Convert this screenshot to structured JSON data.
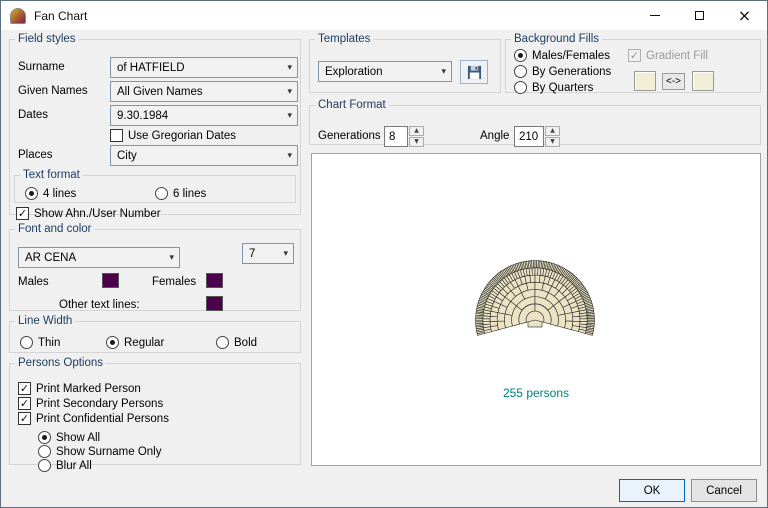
{
  "window": {
    "title": "Fan Chart"
  },
  "icons": {
    "combo_arrow": "▾",
    "check": "✓",
    "spin_up": "▲",
    "spin_down": "▼",
    "close": "×"
  },
  "field_styles": {
    "label": "Field styles",
    "surname": {
      "label": "Surname",
      "value": "of HATFIELD"
    },
    "given_names": {
      "label": "Given Names",
      "value": "All Given Names"
    },
    "dates": {
      "label": "Dates",
      "value": "9.30.1984"
    },
    "use_gregorian_label": "Use Gregorian Dates",
    "places": {
      "label": "Places",
      "value": "City"
    },
    "text_format": {
      "label": "Text format",
      "options": [
        "4 lines",
        "6 lines"
      ],
      "selected": "4 lines"
    },
    "show_ahn_label": "Show Ahn./User Number"
  },
  "font_and_color": {
    "label": "Font and color",
    "font_value": "AR CENA",
    "size_value": "7",
    "males_label": "Males",
    "females_label": "Females",
    "other_label": "Other text lines:",
    "males_color": "#4c004c",
    "females_color": "#4c004c",
    "other_color": "#4c004c"
  },
  "line_width": {
    "label": "Line Width",
    "options": [
      "Thin",
      "Regular",
      "Bold"
    ],
    "selected": "Regular"
  },
  "persons_options": {
    "label": "Persons Options",
    "checkboxes": [
      "Print Marked Person",
      "Print Secondary Persons",
      "Print Confidential Persons"
    ],
    "radios": [
      "Show All",
      "Show Surname Only",
      "Blur All"
    ],
    "selected_radio": "Show All"
  },
  "templates": {
    "label": "Templates",
    "value": "Exploration"
  },
  "background_fills": {
    "label": "Background Fills",
    "options": [
      "Males/Females",
      "By Generations",
      "By Quarters"
    ],
    "selected": "Males/Females",
    "gradient_fill_label": "Gradient Fill",
    "swap_label": "<->",
    "fill_color": "#f2eed6"
  },
  "chart_format": {
    "label": "Chart Format",
    "generations_label": "Generations",
    "generations_value": "8",
    "angle_label": "Angle",
    "angle_value": "210"
  },
  "preview": {
    "count": "255",
    "unit": "persons",
    "count_color": "#008080",
    "fan": {
      "generations": 8,
      "angle": 210,
      "fill": "#ece3c5",
      "stroke": "#1f1f1f"
    }
  },
  "actions": {
    "ok": "OK",
    "cancel": "Cancel"
  }
}
